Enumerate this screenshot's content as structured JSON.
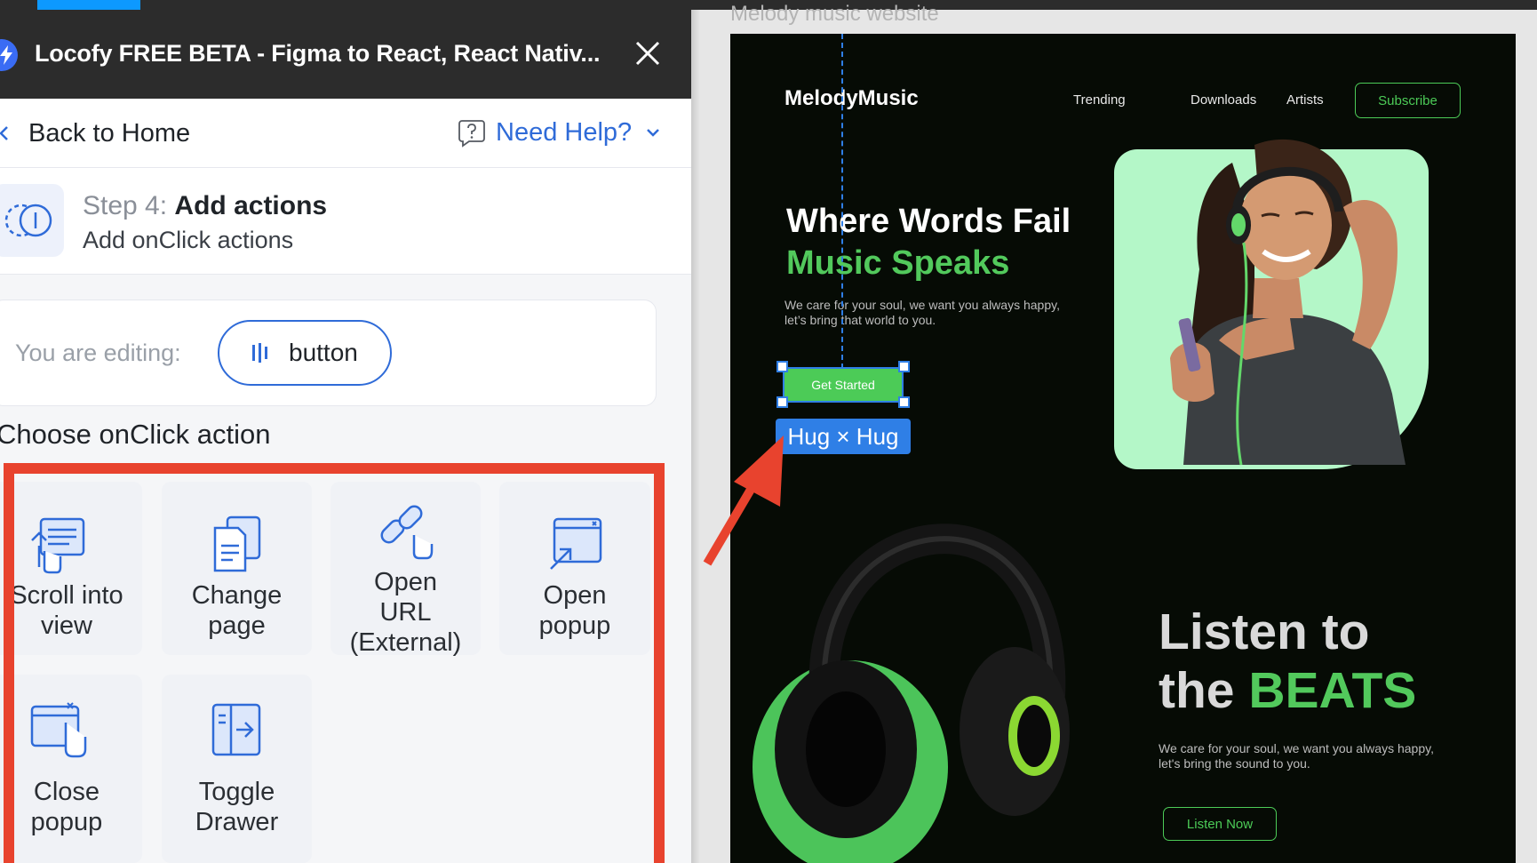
{
  "plugin": {
    "title": "Locofy FREE BETA - Figma to React, React Nativ...",
    "back_label": "Back to Home",
    "help_label": "Need Help?",
    "step": {
      "number_label": "Step 4:",
      "name": "Add actions",
      "subtitle": "Add onClick actions"
    },
    "editing": {
      "label": "You are editing:",
      "element": "button"
    },
    "choose_title": "Choose onClick action",
    "actions": [
      {
        "label": "Scroll into\nview",
        "icon": "scroll-into-view-icon"
      },
      {
        "label": "Change\npage",
        "icon": "change-page-icon"
      },
      {
        "label": "Open\nURL\n(External)",
        "icon": "open-url-icon"
      },
      {
        "label": "Open\npopup",
        "icon": "open-popup-icon"
      },
      {
        "label": "Close\npopup",
        "icon": "close-popup-icon"
      },
      {
        "label": "Toggle\nDrawer",
        "icon": "toggle-drawer-icon"
      }
    ],
    "highlight_color": "#e8432e",
    "accent_color": "#2f6bd8"
  },
  "canvas": {
    "frame_label": "Melody music website",
    "site": {
      "logo": "MelodyMusic",
      "nav": [
        "Trending",
        "Downloads",
        "Artists"
      ],
      "subscribe": "Subscribe",
      "hero_line1": "Where Words Fail",
      "hero_line2": "Music Speaks",
      "hero_desc": "We care for your soul, we want you always happy, let’s bring that world to you.",
      "cta": "Get Started",
      "listen_line1": "Listen to",
      "listen_line2_a": "the ",
      "listen_line2_b": "BEATS",
      "listen_desc": "We care for your soul, we want you always happy, let's bring the sound to you.",
      "listen_cta": "Listen Now",
      "brand_green": "#52c95c"
    },
    "selection": {
      "badge": "Hug × Hug"
    }
  }
}
